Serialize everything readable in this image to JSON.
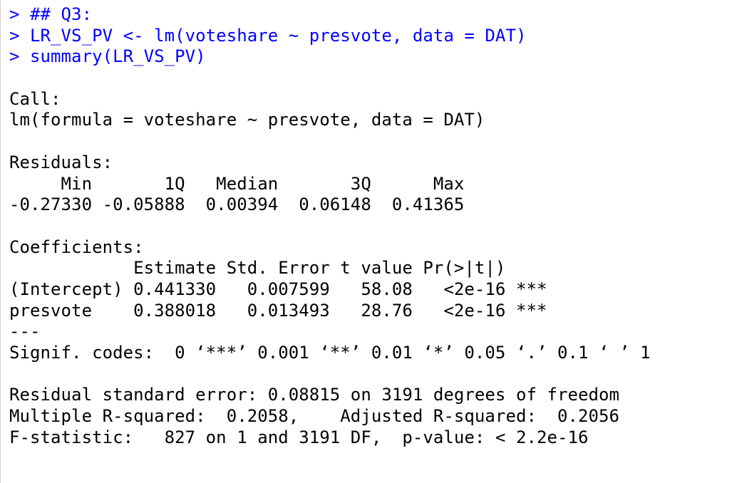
{
  "console": {
    "lines": [
      {
        "kind": "input",
        "text": "> ## Q3:"
      },
      {
        "kind": "input",
        "text": "> LR_VS_PV <- lm(voteshare ~ presvote, data = DAT)"
      },
      {
        "kind": "input",
        "text": "> summary(LR_VS_PV)"
      },
      {
        "kind": "output",
        "text": ""
      },
      {
        "kind": "output",
        "text": "Call:"
      },
      {
        "kind": "output",
        "text": "lm(formula = voteshare ~ presvote, data = DAT)"
      },
      {
        "kind": "output",
        "text": ""
      },
      {
        "kind": "output",
        "text": "Residuals:"
      },
      {
        "kind": "output",
        "text": "     Min       1Q   Median       3Q      Max "
      },
      {
        "kind": "output",
        "text": "-0.27330 -0.05888  0.00394  0.06148  0.41365 "
      },
      {
        "kind": "output",
        "text": ""
      },
      {
        "kind": "output",
        "text": "Coefficients:"
      },
      {
        "kind": "output",
        "text": "            Estimate Std. Error t value Pr(>|t|)    "
      },
      {
        "kind": "output",
        "text": "(Intercept) 0.441330   0.007599   58.08   <2e-16 ***"
      },
      {
        "kind": "output",
        "text": "presvote    0.388018   0.013493   28.76   <2e-16 ***"
      },
      {
        "kind": "output",
        "text": "---"
      },
      {
        "kind": "output",
        "text": "Signif. codes:  0 ‘***’ 0.001 ‘**’ 0.01 ‘*’ 0.05 ‘.’ 0.1 ‘ ’ 1"
      },
      {
        "kind": "output",
        "text": ""
      },
      {
        "kind": "output",
        "text": "Residual standard error: 0.08815 on 3191 degrees of freedom"
      },
      {
        "kind": "output",
        "text": "Multiple R-squared:  0.2058,\tAdjusted R-squared:  0.2056 "
      },
      {
        "kind": "output",
        "text": "F-statistic:   827 on 1 and 3191 DF,  p-value: < 2.2e-16"
      }
    ]
  }
}
